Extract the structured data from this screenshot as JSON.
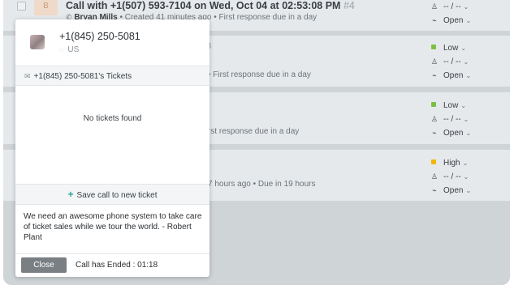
{
  "list": {
    "row1": {
      "avatar_letter": "B",
      "title": "Call with +1(507) 593-7104 on Wed, Oct 04 at 02:53:08 PM",
      "ticket_num": "#4",
      "agent": "Bryan Mills",
      "created": "Created 41 minutes ago",
      "due": "First response due in a day",
      "priority": "",
      "group": "-- / --",
      "status": "Open"
    },
    "row2": {
      "partial_title": "3",
      "due": "First response due in a day",
      "priority": "Low",
      "group": "-- / --",
      "status": "Open"
    },
    "row3": {
      "due": "rst response due in a day",
      "priority": "Low",
      "group": "-- / --",
      "status": "Open"
    },
    "row4": {
      "created": "7 hours ago",
      "due": "Due in 19 hours",
      "priority": "High",
      "group": "-- / --",
      "status": "Open"
    }
  },
  "call_panel": {
    "phone_number": "+1(845) 250-5081",
    "location": "US",
    "tickets_header": "+1(845) 250-5081's Tickets",
    "no_tickets": "No tickets found",
    "save_label": "Save call to new ticket",
    "note": "We need an awesome phone system to take care of ticket sales while we tour the world. - Robert Plant",
    "close_label": "Close",
    "status": "Call has Ended : 01:18"
  },
  "colors": {
    "low": "#7bc043",
    "high": "#f5b400",
    "accent": "#2aa79b"
  },
  "icons": {
    "agent": "person-icon",
    "status": "activity-icon",
    "location": "location-pin-icon",
    "tickets": "ticket-icon",
    "add": "plus-icon"
  }
}
